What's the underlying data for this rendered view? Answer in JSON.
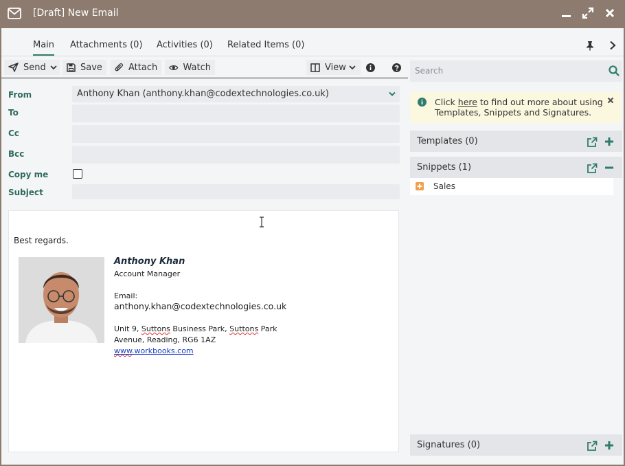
{
  "window": {
    "title": "[Draft] New Email"
  },
  "tabs": [
    {
      "label": "Main"
    },
    {
      "label": "Attachments (0)"
    },
    {
      "label": "Activities (0)"
    },
    {
      "label": "Related Items (0)"
    }
  ],
  "toolbar": {
    "send_label": "Send",
    "save_label": "Save",
    "attach_label": "Attach",
    "watch_label": "Watch",
    "view_label": "View"
  },
  "form": {
    "from_label": "From",
    "from_value": "Anthony Khan (anthony.khan@codextechnologies.co.uk)",
    "to_label": "To",
    "cc_label": "Cc",
    "bcc_label": "Bcc",
    "copy_me_label": "Copy me",
    "subject_label": "Subject"
  },
  "body": {
    "greeting": "Best regards.",
    "signature": {
      "name": "Anthony Khan",
      "job_title": "Account Manager",
      "email_label": "Email:",
      "email": "anthony.khan@codextechnologies.co.uk",
      "address_line1_a": "Unit 9, ",
      "address_line1_b": "Suttons",
      "address_line1_c": " Business Park, ",
      "address_line1_d": "Suttons",
      "address_line1_e": " Park",
      "address_line2": "Avenue, Reading, RG6 1AZ",
      "website_a": "www",
      "website_b": ".workbooks.com"
    }
  },
  "right_panel": {
    "search_placeholder": "Search",
    "info": {
      "text_before": "Click ",
      "link": "here",
      "text_after": " to find out more about using Templates, Snippets and Signatures."
    },
    "templates_label": "Templates (0)",
    "snippets_label": "Snippets (1)",
    "snippet_items": [
      {
        "label": "Sales"
      }
    ],
    "signatures_label": "Signatures (0)"
  },
  "colors": {
    "titlebar": "#8c7b6e",
    "accent": "#2e7d6b",
    "label_green": "#2e6b5e",
    "info_bg": "#fbf8df",
    "snippet_plus": "#f0a04b"
  }
}
